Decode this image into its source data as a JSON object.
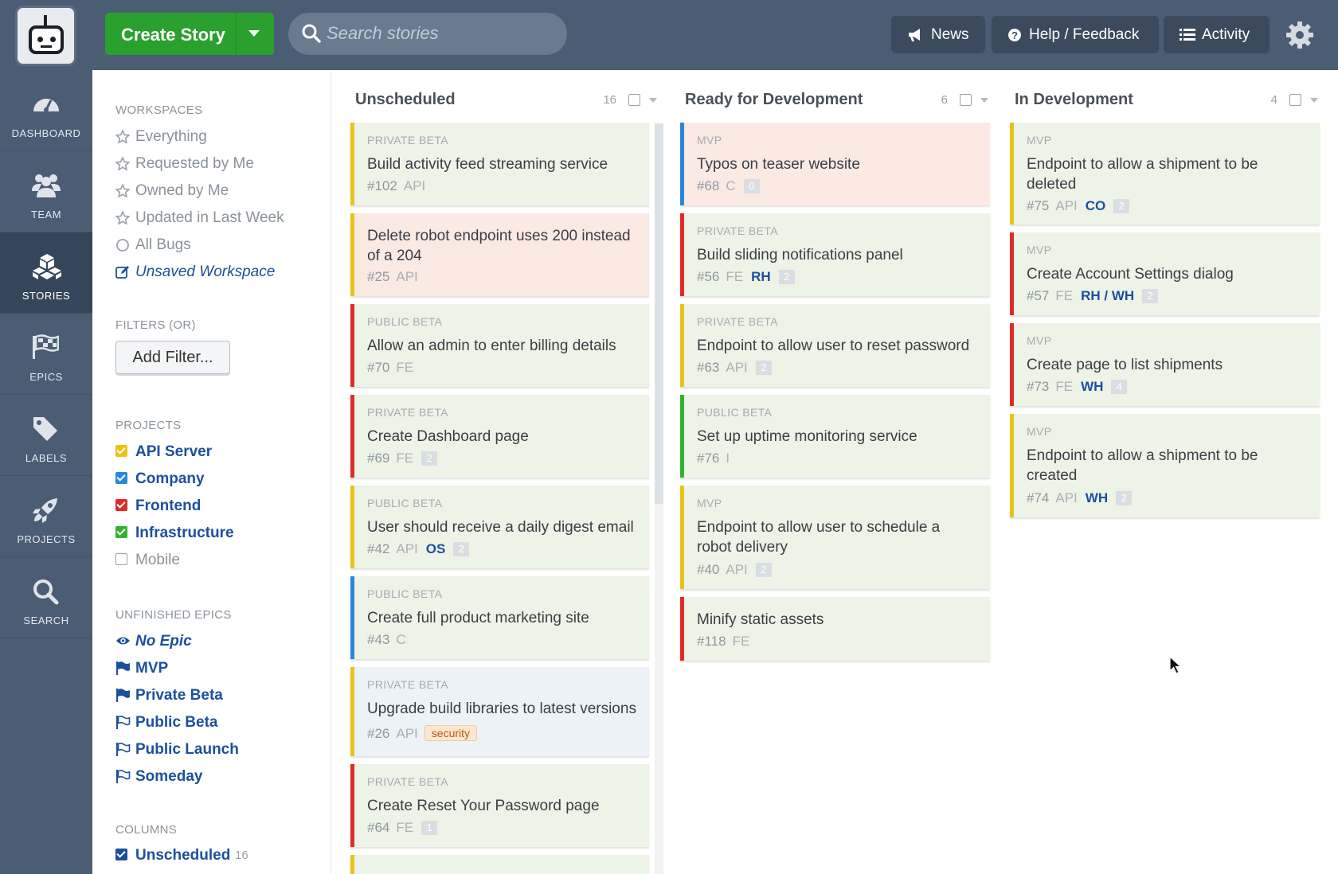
{
  "topbar": {
    "create_story": "Create Story",
    "search_placeholder": "Search stories",
    "news": "News",
    "help": "Help / Feedback",
    "activity": "Activity"
  },
  "leftnav": {
    "dashboard": "DASHBOARD",
    "team": "TEAM",
    "stories": "STORIES",
    "epics": "EPICS",
    "labels": "LABELS",
    "projects": "PROJECTS",
    "search": "SEARCH"
  },
  "sidebar": {
    "workspaces_head": "WORKSPACES",
    "workspaces": [
      "Everything",
      "Requested by Me",
      "Owned by Me",
      "Updated in Last Week",
      "All Bugs",
      "Unsaved Workspace"
    ],
    "filters_head": "FILTERS (OR)",
    "add_filter": "Add Filter...",
    "projects_head": "PROJECTS",
    "projects": [
      {
        "name": "API Server",
        "color": "#e8c419",
        "checked": true
      },
      {
        "name": "Company",
        "color": "#2b86d9",
        "checked": true
      },
      {
        "name": "Frontend",
        "color": "#e02b2b",
        "checked": true
      },
      {
        "name": "Infrastructure",
        "color": "#34b130",
        "checked": true
      },
      {
        "name": "Mobile",
        "color": "#ffffff",
        "checked": false
      }
    ],
    "epics_head": "UNFINISHED EPICS",
    "epics": [
      "No Epic",
      "MVP",
      "Private Beta",
      "Public Beta",
      "Public Launch",
      "Someday"
    ],
    "columns_head": "COLUMNS",
    "columns": [
      {
        "name": "Unscheduled",
        "count": "16"
      }
    ]
  },
  "board": {
    "columns": [
      {
        "name": "Unscheduled",
        "count": "16"
      },
      {
        "name": "Ready for Development",
        "count": "6"
      },
      {
        "name": "In Development",
        "count": "4"
      }
    ],
    "col1": [
      {
        "epic": "PRIVATE BETA",
        "title1": "Build activity feed streaming service",
        "id": "#102",
        "proj": "API"
      },
      {
        "epic": "",
        "title1": "Delete robot endpoint uses 200 instead",
        "title2": "of a 204",
        "id": "#25",
        "proj": "API"
      },
      {
        "epic": "PUBLIC BETA",
        "title1": "Allow an admin to enter billing details",
        "id": "#70",
        "proj": "FE"
      },
      {
        "epic": "PRIVATE BETA",
        "title1": "Create Dashboard page",
        "id": "#69",
        "proj": "FE",
        "est": "2"
      },
      {
        "epic": "PUBLIC BETA",
        "title1": "User should receive a daily digest email",
        "id": "#42",
        "proj": "API",
        "owner": "OS",
        "est": "2"
      },
      {
        "epic": "PUBLIC BETA",
        "title1": "Create full product marketing site",
        "id": "#43",
        "proj": "C"
      },
      {
        "epic": "PRIVATE BETA",
        "title1": "Upgrade build libraries to latest versions",
        "id": "#26",
        "proj": "API",
        "label": "security"
      },
      {
        "epic": "PRIVATE BETA",
        "title1": "Create Reset Your Password page",
        "id": "#64",
        "proj": "FE",
        "est": "1"
      }
    ],
    "col2": [
      {
        "epic": "MVP",
        "title1": "Typos on teaser website",
        "id": "#68",
        "proj": "C",
        "est": "0"
      },
      {
        "epic": "PRIVATE BETA",
        "title1": "Build sliding notifications panel",
        "id": "#56",
        "proj": "FE",
        "owner": "RH",
        "est": "2"
      },
      {
        "epic": "PRIVATE BETA",
        "title1": "Endpoint to allow user to reset password",
        "id": "#63",
        "proj": "API",
        "est": "2"
      },
      {
        "epic": "PUBLIC BETA",
        "title1": "Set up uptime monitoring service",
        "id": "#76",
        "proj": "I"
      },
      {
        "epic": "MVP",
        "title1": "Endpoint to allow user to schedule a",
        "title2": "robot delivery",
        "id": "#40",
        "proj": "API",
        "est": "2"
      },
      {
        "epic": "",
        "title1": "Minify static assets",
        "id": "#118",
        "proj": "FE"
      }
    ],
    "col3": [
      {
        "epic": "MVP",
        "title1": "Endpoint to allow a shipment to be",
        "title2": "deleted",
        "id": "#75",
        "proj": "API",
        "owner": "CO",
        "est": "2"
      },
      {
        "epic": "MVP",
        "title1": "Create Account Settings dialog",
        "id": "#57",
        "proj": "FE",
        "owner": "RH / WH",
        "est": "2"
      },
      {
        "epic": "MVP",
        "title1": "Create page to list shipments",
        "id": "#73",
        "proj": "FE",
        "owner": "WH",
        "est": "4"
      },
      {
        "epic": "MVP",
        "title1": "Endpoint to allow a shipment to be",
        "title2": "created",
        "id": "#74",
        "proj": "API",
        "owner": "WH",
        "est": "2"
      }
    ]
  }
}
